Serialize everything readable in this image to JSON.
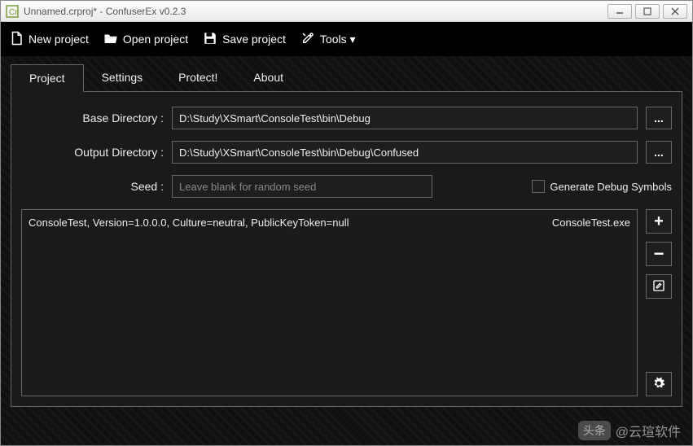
{
  "window": {
    "title": "Unnamed.crproj* - ConfuserEx v0.2.3"
  },
  "menubar": {
    "new_project": "New project",
    "open_project": "Open project",
    "save_project": "Save project",
    "tools": "Tools ▾"
  },
  "tabs": {
    "project": "Project",
    "settings": "Settings",
    "protect": "Protect!",
    "about": "About"
  },
  "form": {
    "base_dir_label": "Base Directory :",
    "base_dir_value": "D:\\Study\\XSmart\\ConsoleTest\\bin\\Debug",
    "output_dir_label": "Output Directory :",
    "output_dir_value": "D:\\Study\\XSmart\\ConsoleTest\\bin\\Debug\\Confused",
    "seed_label": "Seed :",
    "seed_placeholder": "Leave blank for random seed",
    "seed_value": "",
    "generate_debug_label": "Generate Debug Symbols",
    "browse_btn": "..."
  },
  "assemblies": [
    {
      "info": "ConsoleTest, Version=1.0.0.0, Culture=neutral, PublicKeyToken=null",
      "file": "ConsoleTest.exe"
    }
  ],
  "side_buttons": {
    "add": "+",
    "remove": "−"
  },
  "watermark": {
    "badge": "头条",
    "text": "@云瑄软件"
  }
}
